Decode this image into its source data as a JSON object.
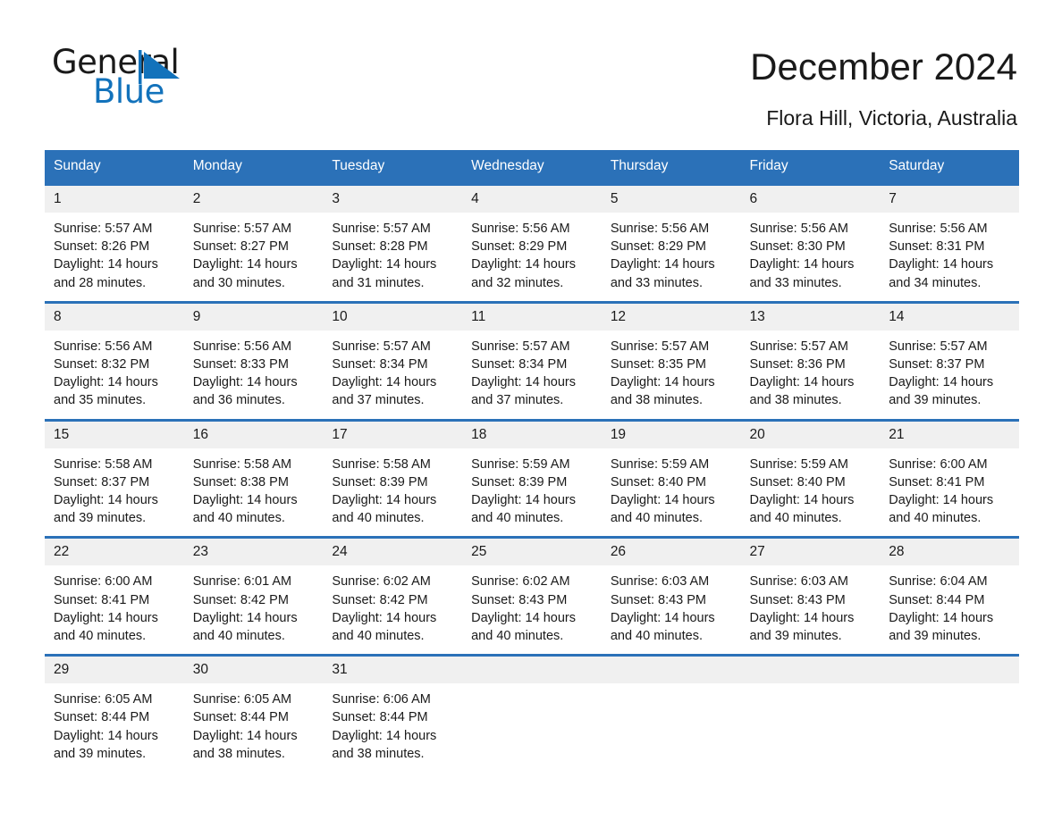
{
  "brand": {
    "word_one": "General",
    "word_two": "Blue",
    "mark_color": "#1272bb",
    "text_color": "#1a1a1a"
  },
  "header": {
    "title": "December 2024",
    "subtitle": "Flora Hill, Victoria, Australia"
  },
  "theme": {
    "header_bg": "#2b71b8",
    "header_text": "#ffffff",
    "daynum_bg": "#f0f0f0",
    "row_rule": "#2b71b8",
    "page_bg": "#ffffff"
  },
  "weekdays": [
    "Sunday",
    "Monday",
    "Tuesday",
    "Wednesday",
    "Thursday",
    "Friday",
    "Saturday"
  ],
  "weeks": [
    [
      {
        "day": "1",
        "sunrise": "Sunrise: 5:57 AM",
        "sunset": "Sunset: 8:26 PM",
        "daylight": "Daylight: 14 hours and 28 minutes."
      },
      {
        "day": "2",
        "sunrise": "Sunrise: 5:57 AM",
        "sunset": "Sunset: 8:27 PM",
        "daylight": "Daylight: 14 hours and 30 minutes."
      },
      {
        "day": "3",
        "sunrise": "Sunrise: 5:57 AM",
        "sunset": "Sunset: 8:28 PM",
        "daylight": "Daylight: 14 hours and 31 minutes."
      },
      {
        "day": "4",
        "sunrise": "Sunrise: 5:56 AM",
        "sunset": "Sunset: 8:29 PM",
        "daylight": "Daylight: 14 hours and 32 minutes."
      },
      {
        "day": "5",
        "sunrise": "Sunrise: 5:56 AM",
        "sunset": "Sunset: 8:29 PM",
        "daylight": "Daylight: 14 hours and 33 minutes."
      },
      {
        "day": "6",
        "sunrise": "Sunrise: 5:56 AM",
        "sunset": "Sunset: 8:30 PM",
        "daylight": "Daylight: 14 hours and 33 minutes."
      },
      {
        "day": "7",
        "sunrise": "Sunrise: 5:56 AM",
        "sunset": "Sunset: 8:31 PM",
        "daylight": "Daylight: 14 hours and 34 minutes."
      }
    ],
    [
      {
        "day": "8",
        "sunrise": "Sunrise: 5:56 AM",
        "sunset": "Sunset: 8:32 PM",
        "daylight": "Daylight: 14 hours and 35 minutes."
      },
      {
        "day": "9",
        "sunrise": "Sunrise: 5:56 AM",
        "sunset": "Sunset: 8:33 PM",
        "daylight": "Daylight: 14 hours and 36 minutes."
      },
      {
        "day": "10",
        "sunrise": "Sunrise: 5:57 AM",
        "sunset": "Sunset: 8:34 PM",
        "daylight": "Daylight: 14 hours and 37 minutes."
      },
      {
        "day": "11",
        "sunrise": "Sunrise: 5:57 AM",
        "sunset": "Sunset: 8:34 PM",
        "daylight": "Daylight: 14 hours and 37 minutes."
      },
      {
        "day": "12",
        "sunrise": "Sunrise: 5:57 AM",
        "sunset": "Sunset: 8:35 PM",
        "daylight": "Daylight: 14 hours and 38 minutes."
      },
      {
        "day": "13",
        "sunrise": "Sunrise: 5:57 AM",
        "sunset": "Sunset: 8:36 PM",
        "daylight": "Daylight: 14 hours and 38 minutes."
      },
      {
        "day": "14",
        "sunrise": "Sunrise: 5:57 AM",
        "sunset": "Sunset: 8:37 PM",
        "daylight": "Daylight: 14 hours and 39 minutes."
      }
    ],
    [
      {
        "day": "15",
        "sunrise": "Sunrise: 5:58 AM",
        "sunset": "Sunset: 8:37 PM",
        "daylight": "Daylight: 14 hours and 39 minutes."
      },
      {
        "day": "16",
        "sunrise": "Sunrise: 5:58 AM",
        "sunset": "Sunset: 8:38 PM",
        "daylight": "Daylight: 14 hours and 40 minutes."
      },
      {
        "day": "17",
        "sunrise": "Sunrise: 5:58 AM",
        "sunset": "Sunset: 8:39 PM",
        "daylight": "Daylight: 14 hours and 40 minutes."
      },
      {
        "day": "18",
        "sunrise": "Sunrise: 5:59 AM",
        "sunset": "Sunset: 8:39 PM",
        "daylight": "Daylight: 14 hours and 40 minutes."
      },
      {
        "day": "19",
        "sunrise": "Sunrise: 5:59 AM",
        "sunset": "Sunset: 8:40 PM",
        "daylight": "Daylight: 14 hours and 40 minutes."
      },
      {
        "day": "20",
        "sunrise": "Sunrise: 5:59 AM",
        "sunset": "Sunset: 8:40 PM",
        "daylight": "Daylight: 14 hours and 40 minutes."
      },
      {
        "day": "21",
        "sunrise": "Sunrise: 6:00 AM",
        "sunset": "Sunset: 8:41 PM",
        "daylight": "Daylight: 14 hours and 40 minutes."
      }
    ],
    [
      {
        "day": "22",
        "sunrise": "Sunrise: 6:00 AM",
        "sunset": "Sunset: 8:41 PM",
        "daylight": "Daylight: 14 hours and 40 minutes."
      },
      {
        "day": "23",
        "sunrise": "Sunrise: 6:01 AM",
        "sunset": "Sunset: 8:42 PM",
        "daylight": "Daylight: 14 hours and 40 minutes."
      },
      {
        "day": "24",
        "sunrise": "Sunrise: 6:02 AM",
        "sunset": "Sunset: 8:42 PM",
        "daylight": "Daylight: 14 hours and 40 minutes."
      },
      {
        "day": "25",
        "sunrise": "Sunrise: 6:02 AM",
        "sunset": "Sunset: 8:43 PM",
        "daylight": "Daylight: 14 hours and 40 minutes."
      },
      {
        "day": "26",
        "sunrise": "Sunrise: 6:03 AM",
        "sunset": "Sunset: 8:43 PM",
        "daylight": "Daylight: 14 hours and 40 minutes."
      },
      {
        "day": "27",
        "sunrise": "Sunrise: 6:03 AM",
        "sunset": "Sunset: 8:43 PM",
        "daylight": "Daylight: 14 hours and 39 minutes."
      },
      {
        "day": "28",
        "sunrise": "Sunrise: 6:04 AM",
        "sunset": "Sunset: 8:44 PM",
        "daylight": "Daylight: 14 hours and 39 minutes."
      }
    ],
    [
      {
        "day": "29",
        "sunrise": "Sunrise: 6:05 AM",
        "sunset": "Sunset: 8:44 PM",
        "daylight": "Daylight: 14 hours and 39 minutes."
      },
      {
        "day": "30",
        "sunrise": "Sunrise: 6:05 AM",
        "sunset": "Sunset: 8:44 PM",
        "daylight": "Daylight: 14 hours and 38 minutes."
      },
      {
        "day": "31",
        "sunrise": "Sunrise: 6:06 AM",
        "sunset": "Sunset: 8:44 PM",
        "daylight": "Daylight: 14 hours and 38 minutes."
      },
      {
        "day": "",
        "sunrise": "",
        "sunset": "",
        "daylight": ""
      },
      {
        "day": "",
        "sunrise": "",
        "sunset": "",
        "daylight": ""
      },
      {
        "day": "",
        "sunrise": "",
        "sunset": "",
        "daylight": ""
      },
      {
        "day": "",
        "sunrise": "",
        "sunset": "",
        "daylight": ""
      }
    ]
  ]
}
